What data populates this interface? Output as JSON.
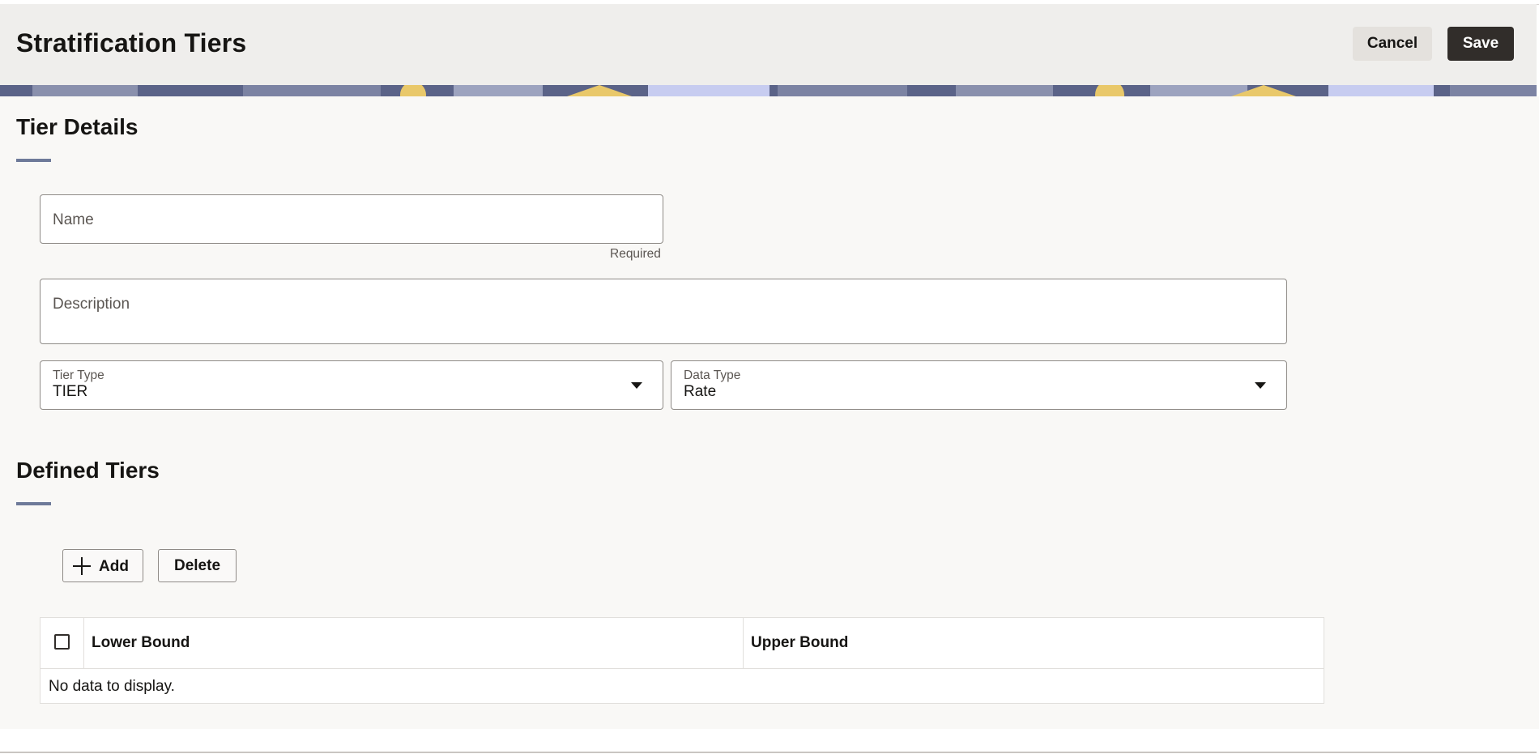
{
  "header": {
    "title": "Stratification Tiers",
    "cancel_label": "Cancel",
    "save_label": "Save"
  },
  "tier_details": {
    "section_title": "Tier Details",
    "name_field": {
      "placeholder": "Name",
      "value": "",
      "helper": "Required"
    },
    "description_field": {
      "placeholder": "Description",
      "value": ""
    },
    "tier_type": {
      "label": "Tier Type",
      "value": "TIER"
    },
    "data_type": {
      "label": "Data Type",
      "value": "Rate"
    }
  },
  "defined_tiers": {
    "section_title": "Defined Tiers",
    "add_label": "Add",
    "delete_label": "Delete",
    "table": {
      "columns": [
        "Lower Bound",
        "Upper Bound"
      ],
      "rows": [],
      "empty_message": "No data to display."
    }
  },
  "colors": {
    "header_bg": "#efeeec",
    "content_bg": "#f9f8f6",
    "primary_button": "#312d2a",
    "section_accent": "#6e7a99"
  },
  "icons": [
    "plus-icon",
    "chevron-down-icon",
    "checkbox-icon"
  ]
}
